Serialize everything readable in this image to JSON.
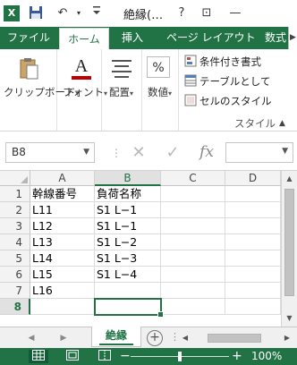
{
  "titlebar": {
    "app_icon": "excel-icon",
    "app_icon_letter": "X",
    "title": "絶縁(…",
    "help": "?",
    "ribbon_display": "⊡",
    "minimize": "—"
  },
  "ribbon_tabs": [
    {
      "label": "ファイル"
    },
    {
      "label": "ホーム"
    },
    {
      "label": "挿入"
    },
    {
      "label": "ページ レイアウト"
    },
    {
      "label": "数式"
    }
  ],
  "ribbon": {
    "clipboard_label": "クリップボード",
    "font_label": "フォント",
    "alignment_label": "配置",
    "number_label": "数値",
    "number_icon": "%",
    "font_icon": "A",
    "conditional_format": "条件付き書式",
    "format_as_table": "テーブルとして",
    "cell_styles": "セルのスタイル",
    "styles_group_label": "スタイル"
  },
  "formula_bar": {
    "name_box": "B8",
    "cancel_icon": "✕",
    "enter_icon": "✓",
    "fx": "fx",
    "formula": ""
  },
  "grid": {
    "columns": [
      "A",
      "B",
      "C",
      "D"
    ],
    "selected_column": "B",
    "rows": [
      {
        "num": "1",
        "A": "幹線番号",
        "B": "負荷名称"
      },
      {
        "num": "2",
        "A": "L11",
        "B": "S1 L−1"
      },
      {
        "num": "3",
        "A": "L12",
        "B": "S1 L−1"
      },
      {
        "num": "4",
        "A": "L13",
        "B": "S1 L−2"
      },
      {
        "num": "5",
        "A": "L14",
        "B": "S1 L−3"
      },
      {
        "num": "6",
        "A": "L15",
        "B": "S1 L−4"
      },
      {
        "num": "7",
        "A": "L16",
        "B": ""
      },
      {
        "num": "8",
        "A": "",
        "B": ""
      }
    ],
    "active_cell": "B8"
  },
  "sheets": {
    "tabs": [
      {
        "label": "絶縁"
      }
    ],
    "active_index": 0
  },
  "statusbar": {
    "zoom": "100%",
    "zoom_minus": "−",
    "zoom_plus": "+"
  },
  "colors": {
    "accent": "#217346",
    "header_bg": "#f3f3f3"
  }
}
